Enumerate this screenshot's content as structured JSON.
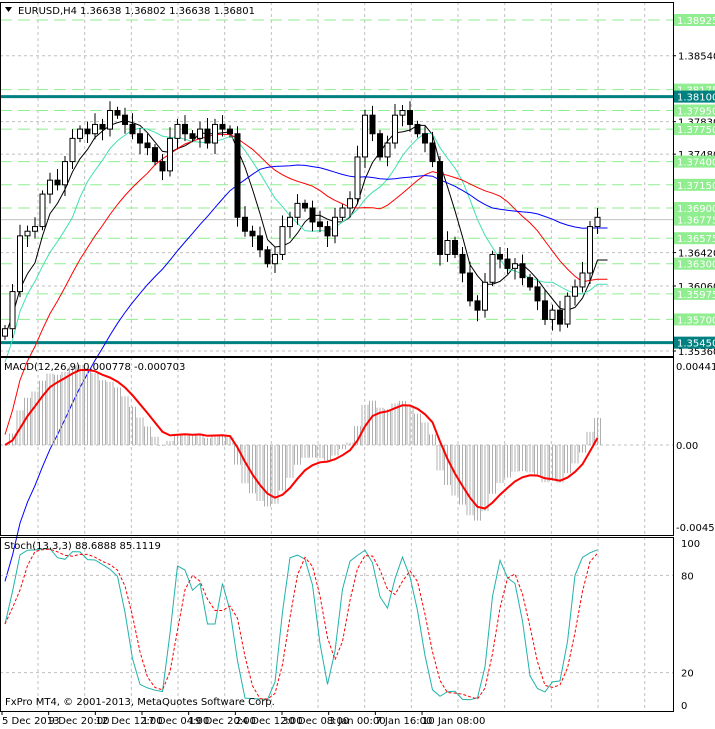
{
  "header": {
    "symbol_label": "EURUSD,H4",
    "ohlc": "1.36638 1.36802 1.36638 1.36801"
  },
  "copyright": "FxPro MT4, © 2001-2013, MetaQuotes Software Corp.",
  "colors": {
    "level_line": "#90ee90",
    "key_level": "#008080",
    "bull": "#ffffff",
    "bear": "#000000",
    "ma_fast": "#000000",
    "ma_mid": "#40e0b0",
    "ma_slow": "#ff0000",
    "ma_long": "#0000ff",
    "macd_signal": "#ff0000",
    "stoch_main": "#20b2aa",
    "stoch_signal": "#ff0000"
  },
  "chart_data": [
    {
      "type": "candlestick",
      "title": "EURUSD,H4",
      "ylim": [
        1.3536,
        1.38925
      ],
      "y_ticks": [
        "1.38540",
        "1.37830",
        "1.37480",
        "1.36420",
        "1.36060",
        "1.35360"
      ],
      "x_ticks": [
        "5 Dec 2013",
        "9 Dec 20:00",
        "12 Dec 12:00",
        "17 Dec 04:00",
        "19 Dec 20:00",
        "24 Dec 12:00",
        "30 Dec 08:00",
        "3 Jan 00:00",
        "7 Jan 16:00",
        "10 Jan 08:00"
      ],
      "closes": [
        1.356,
        1.36,
        1.366,
        1.3665,
        1.367,
        1.3705,
        1.372,
        1.3715,
        1.374,
        1.3765,
        1.3775,
        1.377,
        1.378,
        1.3775,
        1.3795,
        1.379,
        1.378,
        1.377,
        1.376,
        1.3755,
        1.374,
        1.373,
        1.3765,
        1.378,
        1.377,
        1.3765,
        1.3775,
        1.376,
        1.378,
        1.3775,
        1.377,
        1.368,
        1.3665,
        1.366,
        1.3645,
        1.363,
        1.364,
        1.367,
        1.368,
        1.3695,
        1.369,
        1.3675,
        1.367,
        1.366,
        1.368,
        1.369,
        1.37,
        1.3745,
        1.379,
        1.377,
        1.3745,
        1.376,
        1.379,
        1.3795,
        1.378,
        1.377,
        1.376,
        1.374,
        1.364,
        1.3655,
        1.364,
        1.362,
        1.359,
        1.358,
        1.361,
        1.364,
        1.3635,
        1.3625,
        1.363,
        1.3615,
        1.3605,
        1.359,
        1.357,
        1.358,
        1.3565,
        1.3595,
        1.3605,
        1.362,
        1.367,
        1.368
      ],
      "key_levels": [
        "1.38100",
        "1.35450"
      ],
      "levels": [
        "1.38925",
        "1.38175",
        "1.37950",
        "1.37750",
        "1.37400",
        "1.37150",
        "1.36900",
        "1.36575",
        "1.36300",
        "1.35975",
        "1.35700"
      ],
      "bid": "1.36775",
      "moving_average_periods": [
        5,
        10,
        20,
        35
      ]
    },
    {
      "type": "bar",
      "title": "MACD(12,26,9) 0.000778 -0.000703",
      "ylim": [
        -0.004501,
        0.004413
      ],
      "y_ticks": [
        "0.004413",
        "0.00",
        "-0.004501"
      ]
    },
    {
      "type": "line",
      "title": "Stoch(13,3,3) 88.6888 85.1119",
      "ylim": [
        0,
        100
      ],
      "y_ticks": [
        "100",
        "80",
        "20",
        "0"
      ]
    }
  ]
}
